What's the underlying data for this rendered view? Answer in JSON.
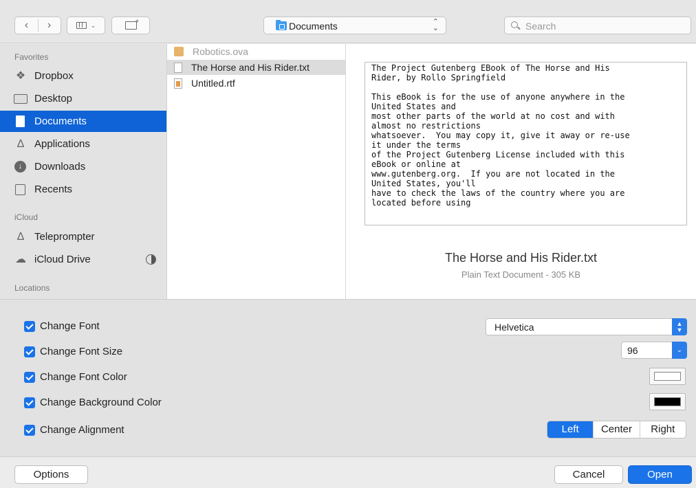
{
  "toolbar": {
    "location_label": "Documents",
    "search_placeholder": "Search"
  },
  "sidebar": {
    "favorites_header": "Favorites",
    "icloud_header": "iCloud",
    "locations_header": "Locations",
    "favorites": [
      {
        "label": "Dropbox",
        "icon": "dropbox-icon"
      },
      {
        "label": "Desktop",
        "icon": "desktop-icon"
      },
      {
        "label": "Documents",
        "icon": "documents-icon",
        "selected": true
      },
      {
        "label": "Applications",
        "icon": "applications-icon"
      },
      {
        "label": "Downloads",
        "icon": "downloads-icon"
      },
      {
        "label": "Recents",
        "icon": "recents-icon"
      }
    ],
    "icloud": [
      {
        "label": "Teleprompter",
        "icon": "applications-icon"
      },
      {
        "label": "iCloud Drive",
        "icon": "cloud-icon"
      }
    ]
  },
  "files": [
    {
      "name": "Robotics.ova",
      "icon": "package-icon",
      "dim": true
    },
    {
      "name": "The Horse and His Rider.txt",
      "icon": "text-file-icon",
      "selected": true
    },
    {
      "name": "Untitled.rtf",
      "icon": "rtf-file-icon"
    }
  ],
  "preview": {
    "text": "The Project Gutenberg EBook of The Horse and His\nRider, by Rollo Springfield\n\nThis eBook is for the use of anyone anywhere in the\nUnited States and\nmost other parts of the world at no cost and with\nalmost no restrictions\nwhatsoever.  You may copy it, give it away or re-use\nit under the terms\nof the Project Gutenberg License included with this\neBook or online at\nwww.gutenberg.org.  If you are not located in the\nUnited States, you'll\nhave to check the laws of the country where you are\nlocated before using",
    "file_name": "The Horse and His Rider.txt",
    "file_meta": "Plain Text Document - 305 KB"
  },
  "options": {
    "change_font": "Change Font",
    "change_font_size": "Change Font Size",
    "change_font_color": "Change Font Color",
    "change_background_color": "Change Background Color",
    "change_alignment": "Change Alignment",
    "font_value": "Helvetica",
    "font_size_value": "96",
    "font_color": "#ffffff",
    "background_color": "#000000",
    "alignment": [
      "Left",
      "Center",
      "Right"
    ],
    "alignment_selected": "Left"
  },
  "buttons": {
    "options": "Options",
    "cancel": "Cancel",
    "open": "Open"
  }
}
